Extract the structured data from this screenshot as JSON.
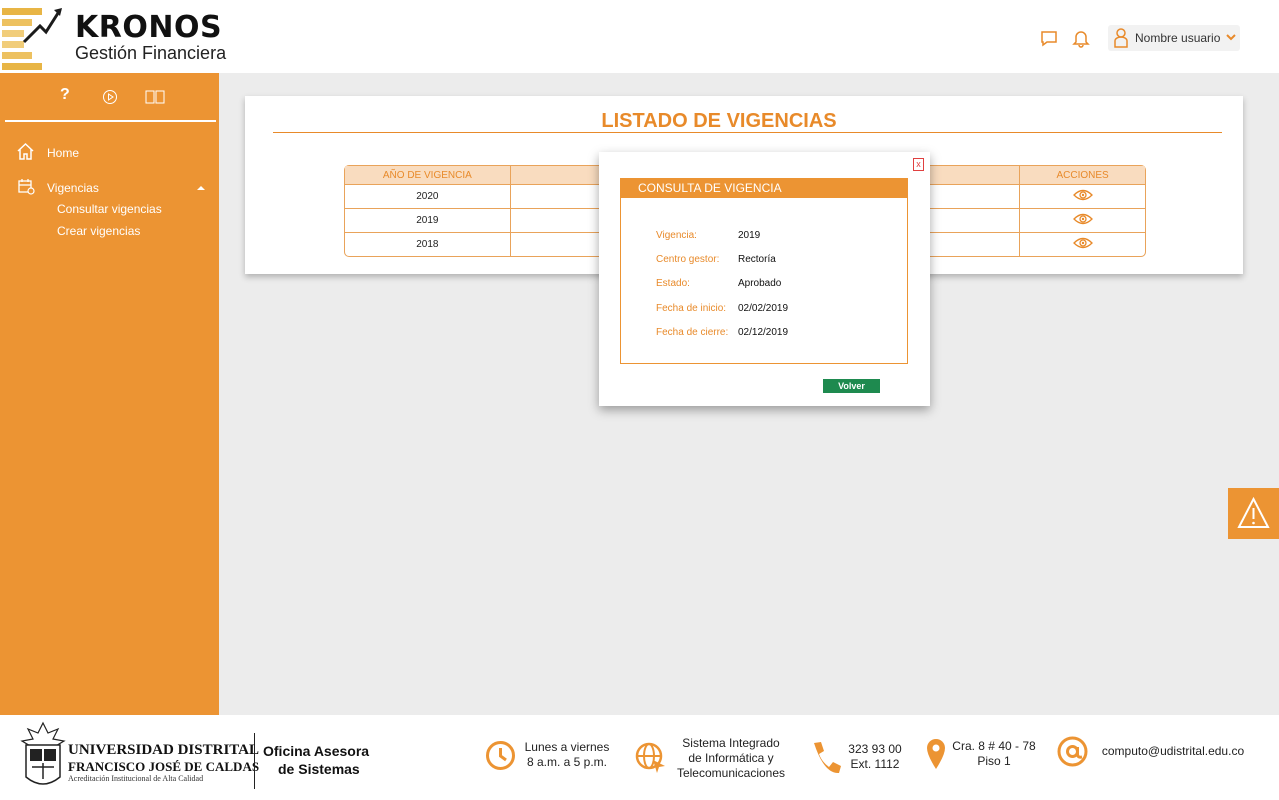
{
  "header": {
    "brand_title": "KRONOS",
    "brand_subtitle": "Gestión Financiera",
    "user_name": "Nombre usuario"
  },
  "sidebar": {
    "tools": [
      "help-icon",
      "play-icon",
      "book-icon"
    ],
    "help_glyph": "?",
    "items": [
      {
        "label": "Home",
        "icon": "home-icon"
      },
      {
        "label": "Vigencias",
        "icon": "calendar-icon",
        "expanded": true,
        "sub_items": [
          "Consultar vigencias",
          "Crear vigencias"
        ]
      }
    ]
  },
  "main": {
    "title": "LISTADO DE VIGENCIAS",
    "table": {
      "headers": [
        "AÑO DE VIGENCIA",
        "",
        "",
        "ACCIONES"
      ],
      "rows": [
        {
          "year": "2020"
        },
        {
          "year": "2019"
        },
        {
          "year": "2018"
        }
      ]
    }
  },
  "modal": {
    "close_label": "x",
    "header": "CONSULTA DE VIGENCIA",
    "fields": [
      {
        "label": "Vigencia:",
        "value": "2019"
      },
      {
        "label": "Centro gestor:",
        "value": "Rectoría"
      },
      {
        "label": "Estado:",
        "value": "Aprobado"
      },
      {
        "label": "Fecha de inicio:",
        "value": "02/02/2019"
      },
      {
        "label": "Fecha de cierre:",
        "value": "02/12/2019"
      }
    ],
    "button_label": "Volver"
  },
  "footer": {
    "university_line1": "UNIVERSIDAD DISTRITAL",
    "university_line2": "FRANCISCO JOSÉ DE CALDAS",
    "university_line3": "Acreditación Institucional de Alta Calidad",
    "office_line1": "Oficina Asesora",
    "office_line2": "de Sistemas",
    "hours_line1": "Lunes a viernes",
    "hours_line2": "8 a.m. a 5 p.m.",
    "system_line1": "Sistema Integrado",
    "system_line2": "de Informática y",
    "system_line3": "Telecomunicaciones",
    "phone_line1": "323 93 00",
    "phone_line2": "Ext. 1112",
    "address_line1": "Cra. 8 # 40 - 78",
    "address_line2": "Piso 1",
    "email": "computo@udistrital.edu.co"
  },
  "colors": {
    "accent": "#ec9433",
    "accent_text": "#e88a2a",
    "button": "#1e8a4f",
    "background": "#ececec"
  }
}
